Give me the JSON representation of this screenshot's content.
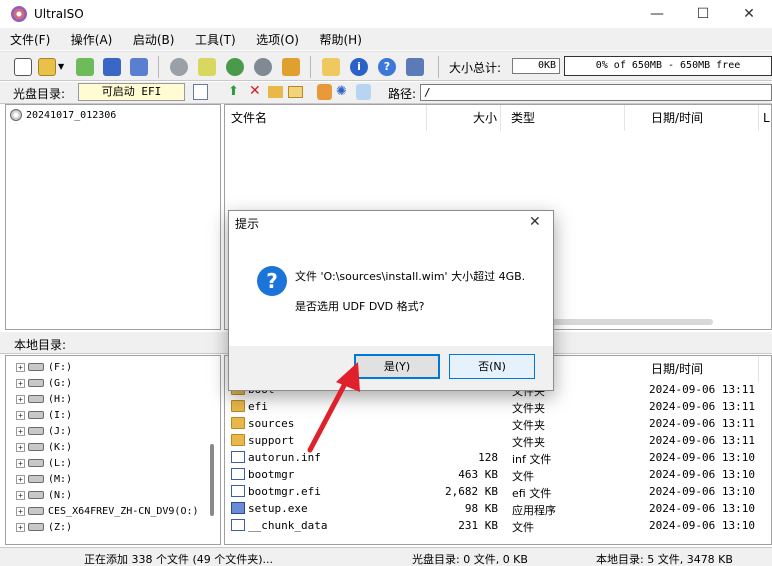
{
  "window": {
    "title": "UltraISO",
    "min": "—",
    "max": "☐",
    "close": "✕"
  },
  "menu": [
    "文件(F)",
    "操作(A)",
    "启动(B)",
    "工具(T)",
    "选项(O)",
    "帮助(H)"
  ],
  "toolbar": {
    "size_label": "大小总计:",
    "size_value": "0KB",
    "capacity": "0% of 650MB - 650MB free",
    "icons": [
      "new-icon",
      "open-icon",
      "dropdown-icon",
      "extract-icon",
      "save-icon",
      "save-as-icon",
      "mount-icon",
      "burn-icon",
      "compress-icon",
      "virtual-drive-icon",
      "cd-icon",
      "properties-icon",
      "info-icon",
      "help-icon",
      "exit-icon"
    ]
  },
  "disc_bar": {
    "label": "光盘目录:",
    "boot_value": "可启动 EFI",
    "path_label": "路径:",
    "path_value": "/"
  },
  "disc_tree": {
    "root": "20241017_012306"
  },
  "file_columns": {
    "name": "文件名",
    "size": "大小",
    "type": "类型",
    "datetime": "日期/时间",
    "extra": "L"
  },
  "local_label": "本地目录:",
  "local_tree": [
    "(F:)",
    "(G:)",
    "(H:)",
    "(I:)",
    "(J:)",
    "(K:)",
    "(L:)",
    "(M:)",
    "(N:)",
    "CES_X64FREV_ZH-CN_DV9(O:)",
    "(Z:)"
  ],
  "local_columns": {
    "datetime": "日期/时间"
  },
  "local_files": [
    {
      "name": "boot",
      "size": "",
      "type": "文件夹",
      "date": "2024-09-06 13:11",
      "kind": "folder"
    },
    {
      "name": "efi",
      "size": "",
      "type": "文件夹",
      "date": "2024-09-06 13:11",
      "kind": "folder"
    },
    {
      "name": "sources",
      "size": "",
      "type": "文件夹",
      "date": "2024-09-06 13:11",
      "kind": "folder"
    },
    {
      "name": "support",
      "size": "",
      "type": "文件夹",
      "date": "2024-09-06 13:11",
      "kind": "folder"
    },
    {
      "name": "autorun.inf",
      "size": "128",
      "type": "inf 文件",
      "date": "2024-09-06 13:10",
      "kind": "file"
    },
    {
      "name": "bootmgr",
      "size": "463 KB",
      "type": "文件",
      "date": "2024-09-06 13:10",
      "kind": "file"
    },
    {
      "name": "bootmgr.efi",
      "size": "2,682 KB",
      "type": "efi 文件",
      "date": "2024-09-06 13:10",
      "kind": "file"
    },
    {
      "name": "setup.exe",
      "size": "98 KB",
      "type": "应用程序",
      "date": "2024-09-06 13:10",
      "kind": "exe"
    },
    {
      "name": "__chunk_data",
      "size": "231 KB",
      "type": "文件",
      "date": "2024-09-06 13:10",
      "kind": "file"
    }
  ],
  "status": {
    "adding": "正在添加 338 个文件 (49 个文件夹)...",
    "disc": "光盘目录: 0 文件, 0 KB",
    "local": "本地目录: 5 文件, 3478 KB"
  },
  "dialog": {
    "title": "提示",
    "line1": "文件 'O:\\sources\\install.wim' 大小超过 4GB.",
    "line2": "是否选用 UDF DVD 格式?",
    "yes": "是(Y)",
    "no": "否(N)",
    "close": "✕"
  },
  "colors": {
    "accent": "#1b74d8",
    "arrow": "#e0202a",
    "boot_box": "#fffbd2"
  }
}
